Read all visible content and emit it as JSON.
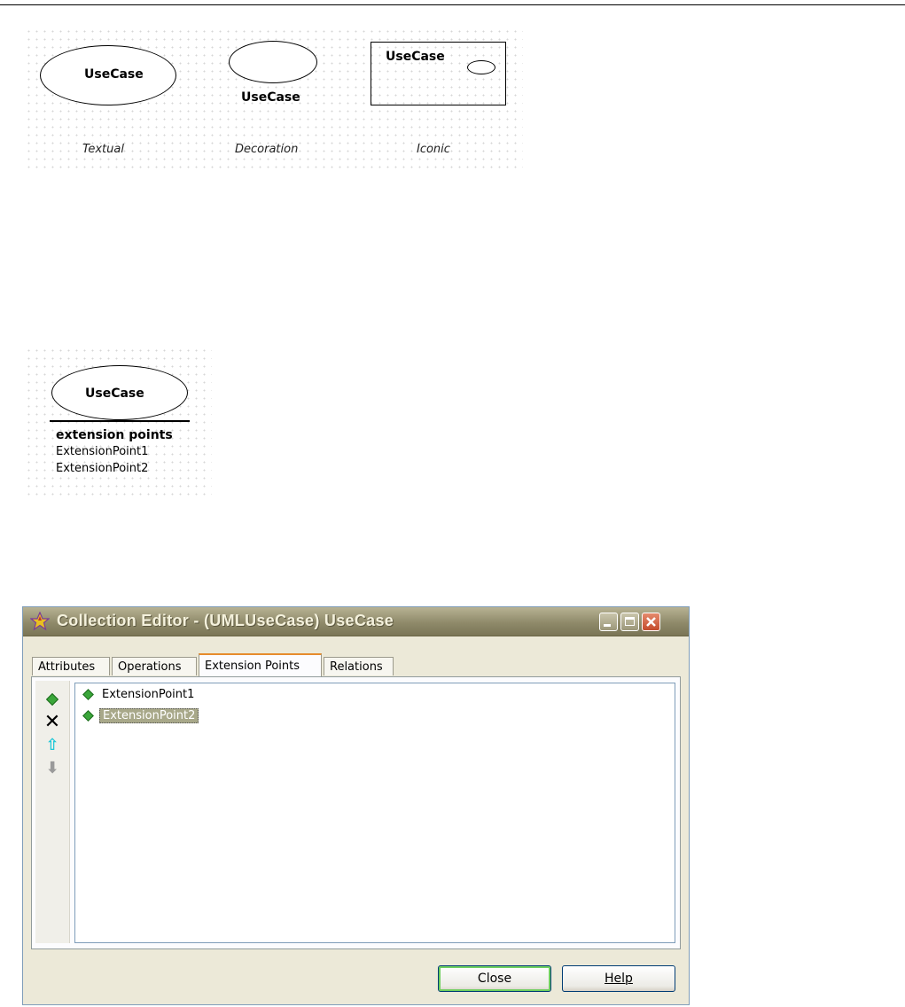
{
  "figure1": {
    "textual": {
      "name": "UseCase",
      "caption": "Textual"
    },
    "decoration": {
      "name": "UseCase",
      "caption": "Decoration"
    },
    "iconic": {
      "name": "UseCase",
      "caption": "Iconic"
    }
  },
  "figure2": {
    "name": "UseCase",
    "compartment_title": "extension points",
    "points": [
      "ExtensionPoint1",
      "ExtensionPoint2"
    ]
  },
  "dialog": {
    "title": "Collection Editor - (UMLUseCase) UseCase",
    "tabs": [
      {
        "label": "Attributes"
      },
      {
        "label": "Operations"
      },
      {
        "label": "Extension Points"
      },
      {
        "label": "Relations"
      }
    ],
    "active_tab": "Extension Points",
    "items": [
      {
        "label": "ExtensionPoint1",
        "selected": false
      },
      {
        "label": "ExtensionPoint2",
        "selected": true
      }
    ],
    "toolbar": [
      "add-icon",
      "delete-icon",
      "move-up-icon",
      "move-down-icon"
    ],
    "buttons": {
      "close": "Close",
      "help": "Help"
    },
    "colors": {
      "active_tab_accent": "#e68b2c",
      "selection": "#a8a889",
      "add_icon": "#3aa63a"
    }
  }
}
